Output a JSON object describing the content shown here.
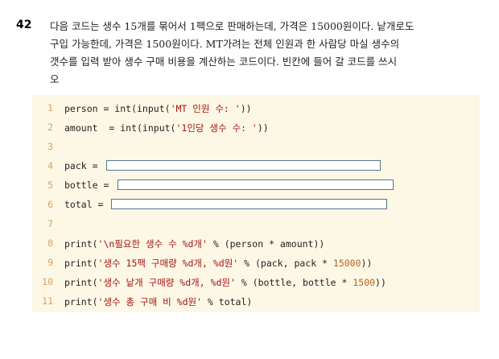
{
  "question": {
    "number": "42",
    "lines": [
      "다음 코드는 생수 15개를 묶어서 1팩으로 판매하는데, 가격은 15000원이다. 낱개로도",
      "구입 가능한데, 가격은 1500원이다. MT가려는 전체 인원과 한 사람당 마실 생수의",
      "갯수를 입력 받아 생수 구매 비용을 계산하는 코드이다. 빈칸에 들어 갈 코드를 쓰시",
      "오"
    ]
  },
  "code": {
    "line_numbers": [
      "1",
      "2",
      "3",
      "4",
      "5",
      "6",
      "7",
      "8",
      "9",
      "10",
      "11"
    ],
    "l1": {
      "pre": "person = int(input(",
      "str": "'MT 인원 수: '",
      "post": "))"
    },
    "l2": {
      "pre": "amount  = int(input(",
      "str": "'1인당 생수 수: '",
      "post": "))"
    },
    "l4": {
      "pre": "pack = "
    },
    "l5": {
      "pre": "bottle = "
    },
    "l6": {
      "pre": "total = "
    },
    "l8": {
      "pre": "print(",
      "str": "'\\n필요한 생수 수 %d개'",
      "post": " % (person * amount))"
    },
    "l9": {
      "pre": "print(",
      "str": "'생수 15팩 구매량 %d개, %d원'",
      "post": " % (pack, pack * ",
      "num": "15000",
      "end": "))"
    },
    "l10": {
      "pre": "print(",
      "str": "'생수 낱개 구매량 %d개, %d원'",
      "post": " % (bottle, bottle * ",
      "num": "1500",
      "end": "))"
    },
    "l11": {
      "pre": "print(",
      "str": "'생수 총 구매 비 %d원'",
      "post": " % total)"
    }
  }
}
